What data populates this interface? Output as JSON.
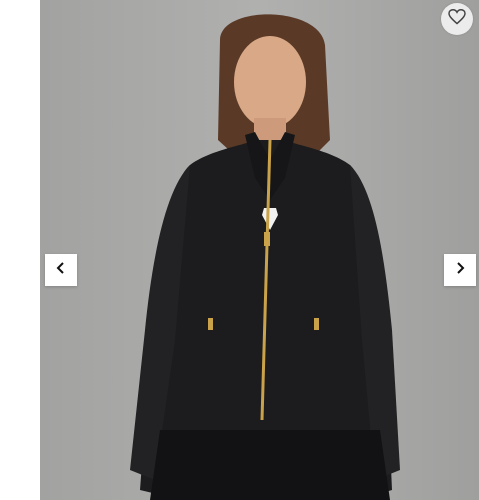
{
  "product_gallery": {
    "image_subject": "",
    "favorite_icon": "heart-outline-icon",
    "prev_icon": "chevron-left-icon",
    "next_icon": "chevron-right-icon",
    "colors": {
      "background": "#a7a7a6",
      "jacket": "#1c1c1e",
      "zipper": "#c9a24a",
      "button_bg": "#ffffff"
    }
  }
}
